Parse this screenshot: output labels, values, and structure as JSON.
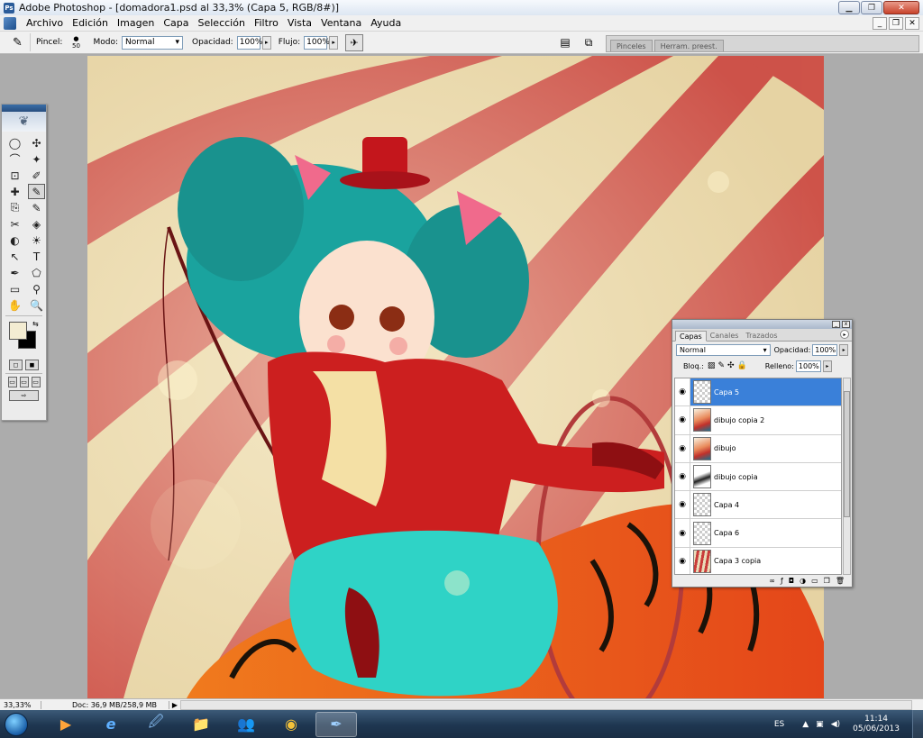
{
  "app": {
    "title": "Adobe Photoshop - [domadora1.psd al 33,3% (Capa 5, RGB/8#)]",
    "logo": "Ps"
  },
  "window_buttons": {
    "minimize": "▁",
    "restore": "❐",
    "close": "✕"
  },
  "doc_buttons": {
    "minimize": "_",
    "restore": "❐",
    "close": "✕"
  },
  "menu": [
    "Archivo",
    "Edición",
    "Imagen",
    "Capa",
    "Selección",
    "Filtro",
    "Vista",
    "Ventana",
    "Ayuda"
  ],
  "options": {
    "tool_icon": "✎",
    "brush_label": "Pincel:",
    "brush_size": "50",
    "mode_label": "Modo:",
    "mode_value": "Normal",
    "opacity_label": "Opacidad:",
    "opacity_value": "100%",
    "flow_label": "Flujo:",
    "flow_value": "100%",
    "palette_tabs": [
      "Pinceles",
      "Herram. preest."
    ]
  },
  "toolbox": {
    "tools": [
      "◯",
      "✣",
      "⌒",
      "✦",
      "⊡",
      "✐",
      "✚",
      "✎",
      "⎘",
      "✎",
      "✂",
      "◈",
      "◐",
      "☀",
      "↖",
      "T",
      "✒",
      "⬠",
      "▭",
      "⚲",
      "✋",
      "🔍"
    ],
    "foreground_color": "#f3ecd2",
    "background_color": "#000000"
  },
  "layers_panel": {
    "tabs": [
      "Capas",
      "Canales",
      "Trazados"
    ],
    "blend_mode": "Normal",
    "opacity_label": "Opacidad:",
    "opacity_value": "100%",
    "lock_label": "Bloq.:",
    "fill_label": "Relleno:",
    "fill_value": "100%",
    "layers": [
      {
        "name": "Capa 5",
        "thumb": "transparent",
        "selected": true
      },
      {
        "name": "dibujo copia 2",
        "thumb": "art",
        "selected": false
      },
      {
        "name": "dibujo",
        "thumb": "art",
        "selected": false
      },
      {
        "name": "dibujo copia",
        "thumb": "lines",
        "selected": false
      },
      {
        "name": "Capa 4",
        "thumb": "transparent",
        "selected": false
      },
      {
        "name": "Capa 6",
        "thumb": "transparent",
        "selected": false
      },
      {
        "name": "Capa 3 copia",
        "thumb": "stripes",
        "selected": false
      }
    ],
    "footer_icons": [
      "∞",
      "ƒ",
      "◘",
      "◑",
      "▭",
      "❒",
      "🗑"
    ]
  },
  "status": {
    "zoom": "33,33%",
    "doc": "Doc: 36,9 MB/258,9 MB"
  },
  "taskbar": {
    "apps": [
      "▶",
      "e",
      "🖉",
      "📁",
      "👥",
      "◉",
      "✒"
    ],
    "language": "ES",
    "time": "11:14",
    "date": "05/06/2013"
  },
  "colors": {
    "accent_selected": "#3a80d9",
    "stripe_red": "#c93c3a",
    "stripe_cream": "#e9d6a6"
  }
}
